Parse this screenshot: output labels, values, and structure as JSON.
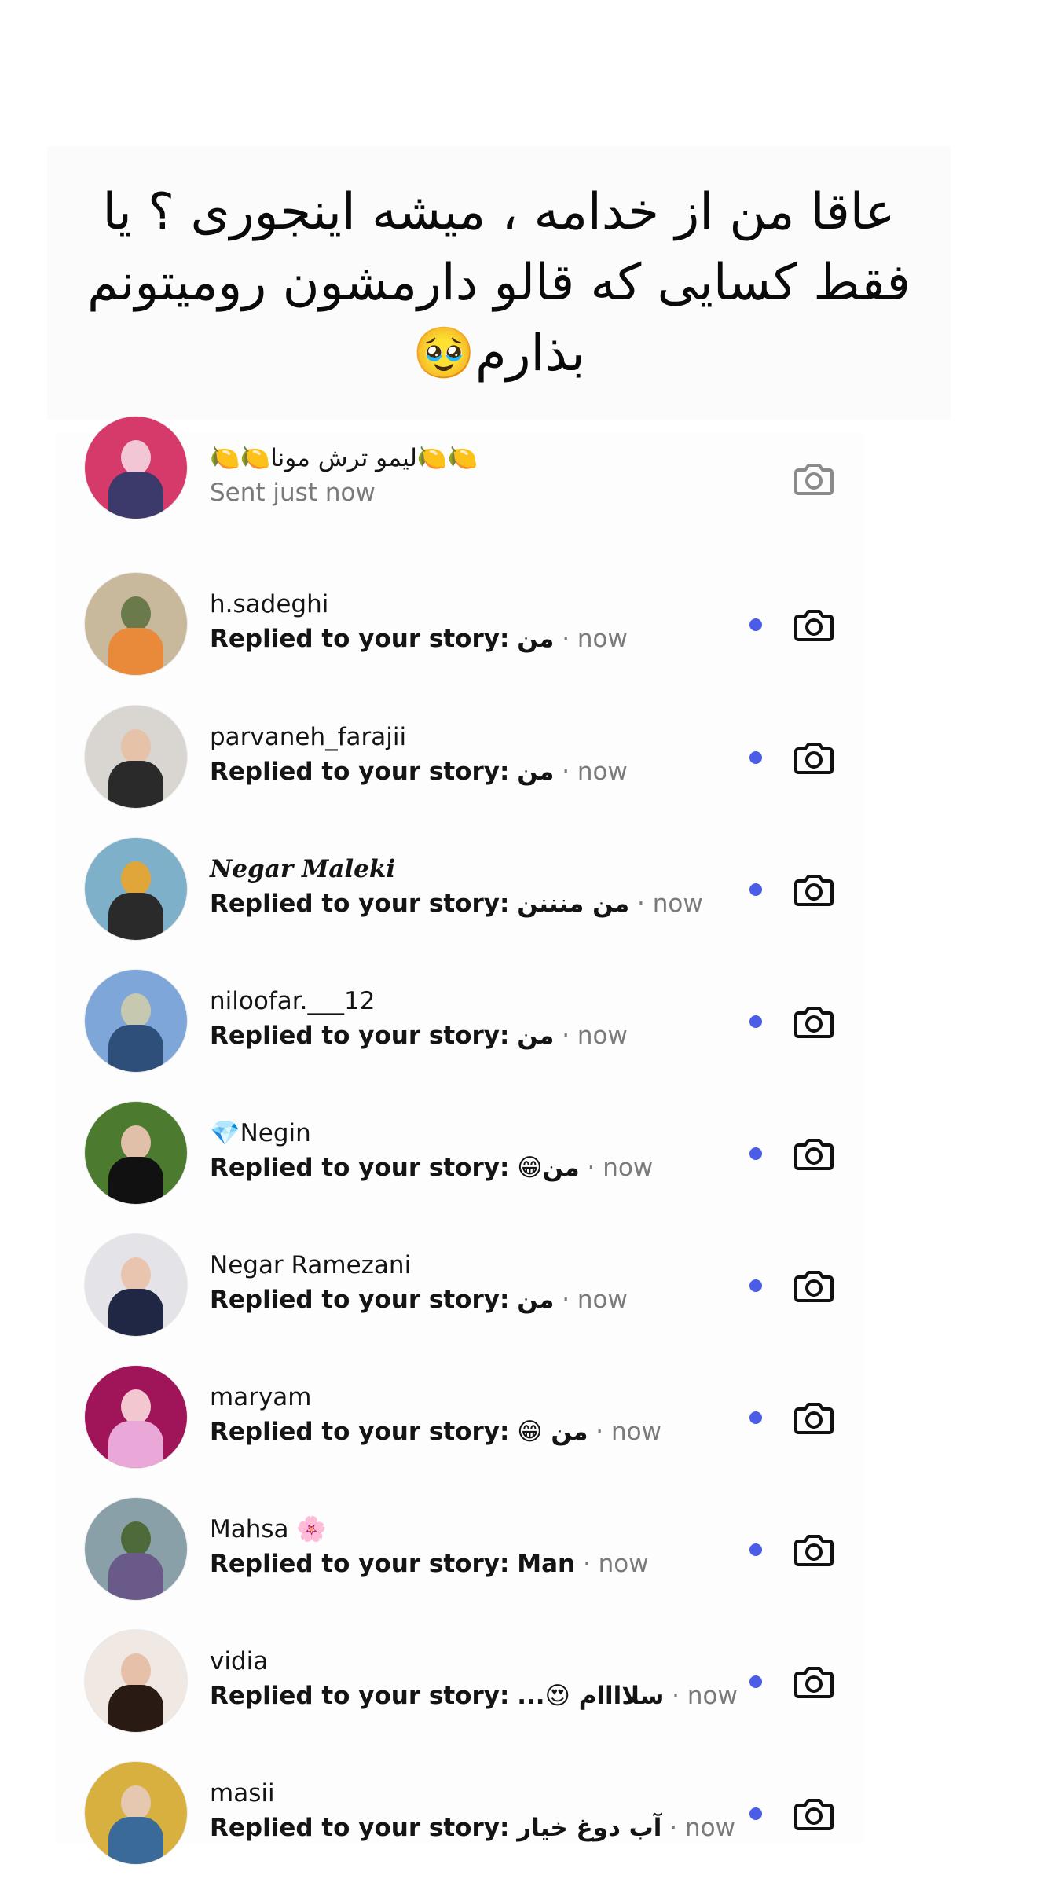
{
  "caption": {
    "text": "عاقا من از خدامه ، میشه اینجوری ؟ یا فقط کسایی که قالو دارمشون رومیتونم بذارم🥹"
  },
  "colors": {
    "accent_dot": "#4a5ce8",
    "muted_text": "#7a7a7a",
    "camera_muted": "#8a8a8a"
  },
  "rows": [
    {
      "name": "🍋🍋لیمو ترش مونا🍋🍋",
      "status": "Sent just now",
      "unread": false,
      "avatar_colors": [
        "#d63a6a",
        "#f3c6d6",
        "#3b3a6a"
      ]
    },
    {
      "name": "h.sadeghi",
      "reply_label": "Replied to your story:",
      "message": "من",
      "time": "· now",
      "unread": true,
      "avatar_colors": [
        "#c8b89c",
        "#e98a3a",
        "#6a7a4a"
      ]
    },
    {
      "name": "parvaneh_farajii",
      "reply_label": "Replied to your story:",
      "message": "من",
      "time": "· now",
      "unread": true,
      "avatar_colors": [
        "#d9d6d1",
        "#2a2a2a",
        "#e6c2a8"
      ]
    },
    {
      "name": "Negar Maleki",
      "name_style": "serif",
      "reply_label": "Replied to your story:",
      "message": "من منننن",
      "time": "· now",
      "unread": true,
      "avatar_colors": [
        "#e1a63a",
        "#2a2a2a",
        "#7fb0c9"
      ]
    },
    {
      "name": "niloofar.___12",
      "reply_label": "Replied to your story:",
      "message": "من",
      "time": "· now",
      "unread": true,
      "avatar_colors": [
        "#7ea6d9",
        "#2e4f7a",
        "#c6c8b0"
      ]
    },
    {
      "name": "💎Negin",
      "reply_label": "Replied to your story:",
      "message": "😁من",
      "time": "· now",
      "unread": true,
      "avatar_colors": [
        "#4c7a2f",
        "#111111",
        "#e0c0a8"
      ]
    },
    {
      "name": "Negar Ramezani",
      "reply_label": "Replied to your story:",
      "message": "من",
      "time": "· now",
      "unread": true,
      "avatar_colors": [
        "#e4e4e8",
        "#1f2744",
        "#e9c4ae"
      ]
    },
    {
      "name": "maryam",
      "reply_label": "Replied to your story:",
      "message": "😁 من",
      "time": "· now",
      "unread": true,
      "avatar_colors": [
        "#a0155a",
        "#e9a8d8",
        "#f2c7d0"
      ]
    },
    {
      "name": "Mahsa 🌸",
      "reply_label": "Replied to your story:",
      "message": "Man",
      "time": "· now",
      "unread": true,
      "avatar_colors": [
        "#8aa0a8",
        "#6a5a8a",
        "#4e6a3a"
      ]
    },
    {
      "name": "vidia",
      "reply_label": "Replied to your story:",
      "message": "...😍 سلاااام",
      "time": "· now",
      "unread": true,
      "avatar_colors": [
        "#f0e8e2",
        "#2a1a14",
        "#e6c0a8"
      ]
    },
    {
      "name": "masii",
      "reply_label": "Replied to your story:",
      "message": "آب دوغ خیار",
      "time": "· now",
      "unread": true,
      "avatar_colors": [
        "#d8b040",
        "#3a6a9a",
        "#e6c8b0"
      ]
    }
  ]
}
